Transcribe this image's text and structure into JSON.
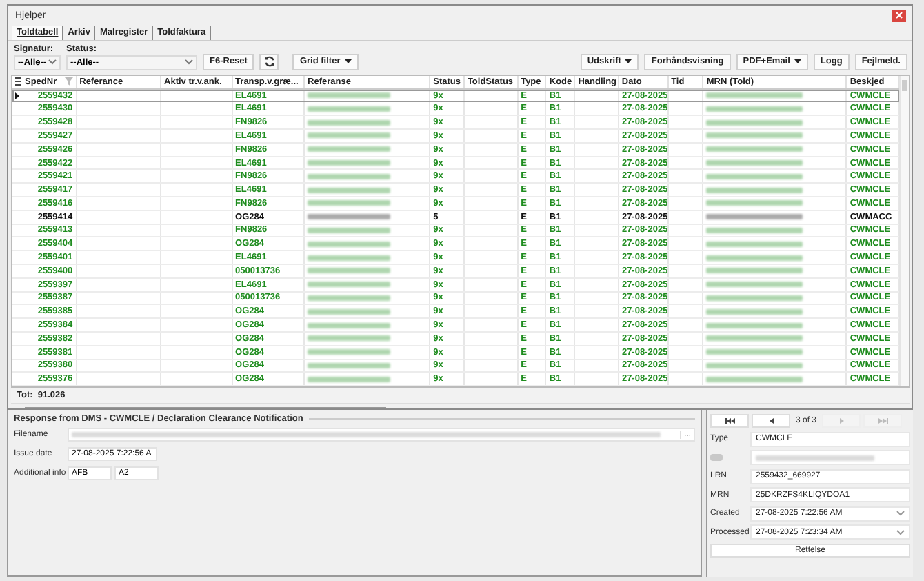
{
  "window": {
    "title": "Hjelper"
  },
  "tabs": [
    {
      "label": "Toldtabell",
      "selected": true
    },
    {
      "label": "Arkiv",
      "selected": false
    },
    {
      "label": "Malregister",
      "selected": false
    },
    {
      "label": "Toldfaktura",
      "selected": false
    }
  ],
  "filters": [
    {
      "label": "Signatur:",
      "value": "--Alle--",
      "kind": "narrow"
    },
    {
      "label": "Status:",
      "value": "--Alle--",
      "kind": "wide"
    }
  ],
  "toolbar_left": [
    {
      "label": "F6-Reset",
      "kind": "button"
    },
    {
      "kind": "refresh"
    },
    {
      "label": "Grid filter",
      "kind": "split"
    }
  ],
  "toolbar_right": [
    {
      "label": "Udskrift",
      "kind": "split"
    },
    {
      "label": "Forhåndsvisning",
      "kind": "button"
    },
    {
      "label": "PDF+Email",
      "kind": "split"
    },
    {
      "label": "Logg",
      "kind": "button"
    },
    {
      "label": "Fejlmeld.",
      "kind": "button"
    }
  ],
  "table": {
    "columns": [
      "SpedNr",
      "Referance",
      "Aktiv tr.v.ank.",
      "Transp.v.græ...",
      "Referanse",
      "Status",
      "ToldStatus",
      "Type",
      "Kode",
      "Handling",
      "Dato",
      "Tid",
      "MRN (Told)",
      "Beskjed"
    ],
    "rows": [
      {
        "sped_nr": "2559432",
        "transp": "EL4691",
        "status": "9x",
        "type": "E",
        "kode": "B1",
        "dato": "27-08-2025",
        "beskjed": "CWMCLE",
        "color": "#1e8c1e",
        "selected": true
      },
      {
        "sped_nr": "2559430",
        "transp": "EL4691",
        "status": "9x",
        "type": "E",
        "kode": "B1",
        "dato": "27-08-2025",
        "beskjed": "CWMCLE",
        "color": "#1e8c1e",
        "selected": false
      },
      {
        "sped_nr": "2559428",
        "transp": "FN9826",
        "status": "9x",
        "type": "E",
        "kode": "B1",
        "dato": "27-08-2025",
        "beskjed": "CWMCLE",
        "color": "#1e8c1e",
        "selected": false
      },
      {
        "sped_nr": "2559427",
        "transp": "EL4691",
        "status": "9x",
        "type": "E",
        "kode": "B1",
        "dato": "27-08-2025",
        "beskjed": "CWMCLE",
        "color": "#1e8c1e",
        "selected": false
      },
      {
        "sped_nr": "2559426",
        "transp": "FN9826",
        "status": "9x",
        "type": "E",
        "kode": "B1",
        "dato": "27-08-2025",
        "beskjed": "CWMCLE",
        "color": "#1e8c1e",
        "selected": false
      },
      {
        "sped_nr": "2559422",
        "transp": "EL4691",
        "status": "9x",
        "type": "E",
        "kode": "B1",
        "dato": "27-08-2025",
        "beskjed": "CWMCLE",
        "color": "#1e8c1e",
        "selected": false
      },
      {
        "sped_nr": "2559421",
        "transp": "FN9826",
        "status": "9x",
        "type": "E",
        "kode": "B1",
        "dato": "27-08-2025",
        "beskjed": "CWMCLE",
        "color": "#1e8c1e",
        "selected": false
      },
      {
        "sped_nr": "2559417",
        "transp": "EL4691",
        "status": "9x",
        "type": "E",
        "kode": "B1",
        "dato": "27-08-2025",
        "beskjed": "CWMCLE",
        "color": "#1e8c1e",
        "selected": false
      },
      {
        "sped_nr": "2559416",
        "transp": "FN9826",
        "status": "9x",
        "type": "E",
        "kode": "B1",
        "dato": "27-08-2025",
        "beskjed": "CWMCLE",
        "color": "#1e8c1e",
        "selected": false
      },
      {
        "sped_nr": "2559414",
        "transp": "OG284",
        "status": "5",
        "type": "E",
        "kode": "B1",
        "dato": "27-08-2025",
        "beskjed": "CWMACC",
        "color": "#111111",
        "selected": false
      },
      {
        "sped_nr": "2559413",
        "transp": "FN9826",
        "status": "9x",
        "type": "E",
        "kode": "B1",
        "dato": "27-08-2025",
        "beskjed": "CWMCLE",
        "color": "#1e8c1e",
        "selected": false
      },
      {
        "sped_nr": "2559404",
        "transp": "OG284",
        "status": "9x",
        "type": "E",
        "kode": "B1",
        "dato": "27-08-2025",
        "beskjed": "CWMCLE",
        "color": "#1e8c1e",
        "selected": false
      },
      {
        "sped_nr": "2559401",
        "transp": "EL4691",
        "status": "9x",
        "type": "E",
        "kode": "B1",
        "dato": "27-08-2025",
        "beskjed": "CWMCLE",
        "color": "#1e8c1e",
        "selected": false
      },
      {
        "sped_nr": "2559400",
        "transp": "050013736",
        "status": "9x",
        "type": "E",
        "kode": "B1",
        "dato": "27-08-2025",
        "beskjed": "CWMCLE",
        "color": "#1e8c1e",
        "selected": false
      },
      {
        "sped_nr": "2559397",
        "transp": "EL4691",
        "status": "9x",
        "type": "E",
        "kode": "B1",
        "dato": "27-08-2025",
        "beskjed": "CWMCLE",
        "color": "#1e8c1e",
        "selected": false
      },
      {
        "sped_nr": "2559387",
        "transp": "050013736",
        "status": "9x",
        "type": "E",
        "kode": "B1",
        "dato": "27-08-2025",
        "beskjed": "CWMCLE",
        "color": "#1e8c1e",
        "selected": false
      },
      {
        "sped_nr": "2559385",
        "transp": "OG284",
        "status": "9x",
        "type": "E",
        "kode": "B1",
        "dato": "27-08-2025",
        "beskjed": "CWMCLE",
        "color": "#1e8c1e",
        "selected": false
      },
      {
        "sped_nr": "2559384",
        "transp": "OG284",
        "status": "9x",
        "type": "E",
        "kode": "B1",
        "dato": "27-08-2025",
        "beskjed": "CWMCLE",
        "color": "#1e8c1e",
        "selected": false
      },
      {
        "sped_nr": "2559382",
        "transp": "OG284",
        "status": "9x",
        "type": "E",
        "kode": "B1",
        "dato": "27-08-2025",
        "beskjed": "CWMCLE",
        "color": "#1e8c1e",
        "selected": false
      },
      {
        "sped_nr": "2559381",
        "transp": "OG284",
        "status": "9x",
        "type": "E",
        "kode": "B1",
        "dato": "27-08-2025",
        "beskjed": "CWMCLE",
        "color": "#1e8c1e",
        "selected": false
      },
      {
        "sped_nr": "2559380",
        "transp": "OG284",
        "status": "9x",
        "type": "E",
        "kode": "B1",
        "dato": "27-08-2025",
        "beskjed": "CWMCLE",
        "color": "#1e8c1e",
        "selected": false
      },
      {
        "sped_nr": "2559376",
        "transp": "OG284",
        "status": "9x",
        "type": "E",
        "kode": "B1",
        "dato": "27-08-2025",
        "beskjed": "CWMCLE",
        "color": "#1e8c1e",
        "selected": false
      }
    ],
    "total": "Tot:  91.026"
  },
  "response": {
    "title": "Response from DMS - CWMCLE / Declaration Clearance Notification",
    "fields": [
      {
        "label": "Filename",
        "kind": "blurred",
        "button": "..."
      },
      {
        "label": "Issue date",
        "kind": "dropdown",
        "value": "27-08-2025 7:22:56 A"
      },
      {
        "label": "Additional info",
        "kind": "pair",
        "values": [
          "AFB",
          "A2"
        ]
      }
    ]
  },
  "detail": {
    "nav": [
      {
        "kind": "first",
        "disabled": false
      },
      {
        "kind": "prev",
        "disabled": false
      },
      {
        "kind": "next",
        "disabled": true
      },
      {
        "kind": "last",
        "disabled": true
      }
    ],
    "pager": "3 of 3",
    "fields": [
      {
        "label": "Type",
        "kind": "text",
        "value": "CWMCLE"
      },
      {
        "kind": "blurred"
      },
      {
        "label": "LRN",
        "kind": "text",
        "value": "2559432_669927"
      },
      {
        "label": "MRN",
        "kind": "text",
        "value": "25DKRZFS4KLIQYDOA1"
      },
      {
        "label": "Created",
        "kind": "dropdown",
        "value": "27-08-2025 7:22:56 AM"
      },
      {
        "label": "Processed",
        "kind": "dropdown",
        "value": "27-08-2025 7:23:34 AM"
      }
    ],
    "button": "Rettelse"
  }
}
